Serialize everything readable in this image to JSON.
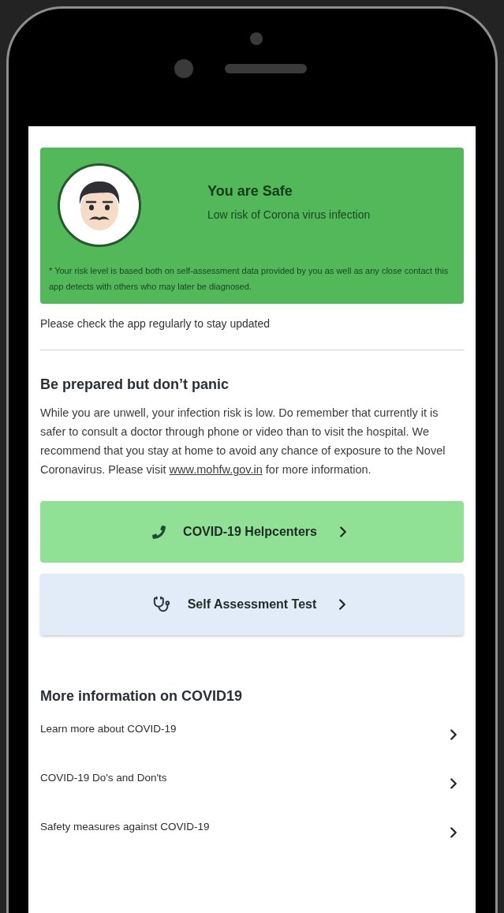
{
  "status_card": {
    "title": "You are Safe",
    "subtitle": "Low risk of Corona virus infection",
    "note": "* Your risk level is based both on self-assessment data provided by you as well as any close contact this app detects with others who may later be diagnosed."
  },
  "reminder": "Please check the app regularly to stay updated",
  "advice": {
    "title": "Be prepared but don’t panic",
    "body": "While you are unwell, your infection risk is low. Do remember that currently it is safer to consult a doctor through phone or video than to visit the hospital. We recommend that you stay at home to avoid any chance of exposure to the Novel Coronavirus. Please visit",
    "link": "www.mohfw.gov.in",
    "body_end": "for more information."
  },
  "action_buttons": [
    {
      "kind": "phone",
      "label": "COVID-19 Helpcenters"
    },
    {
      "kind": "stethoscope",
      "label": "Self Assessment Test"
    }
  ],
  "more_info": {
    "title": "More information on COVID19",
    "items": [
      "Learn more about COVID-19",
      "COVID-19 Do's and Don'ts",
      "Safety measures against COVID-19"
    ]
  }
}
